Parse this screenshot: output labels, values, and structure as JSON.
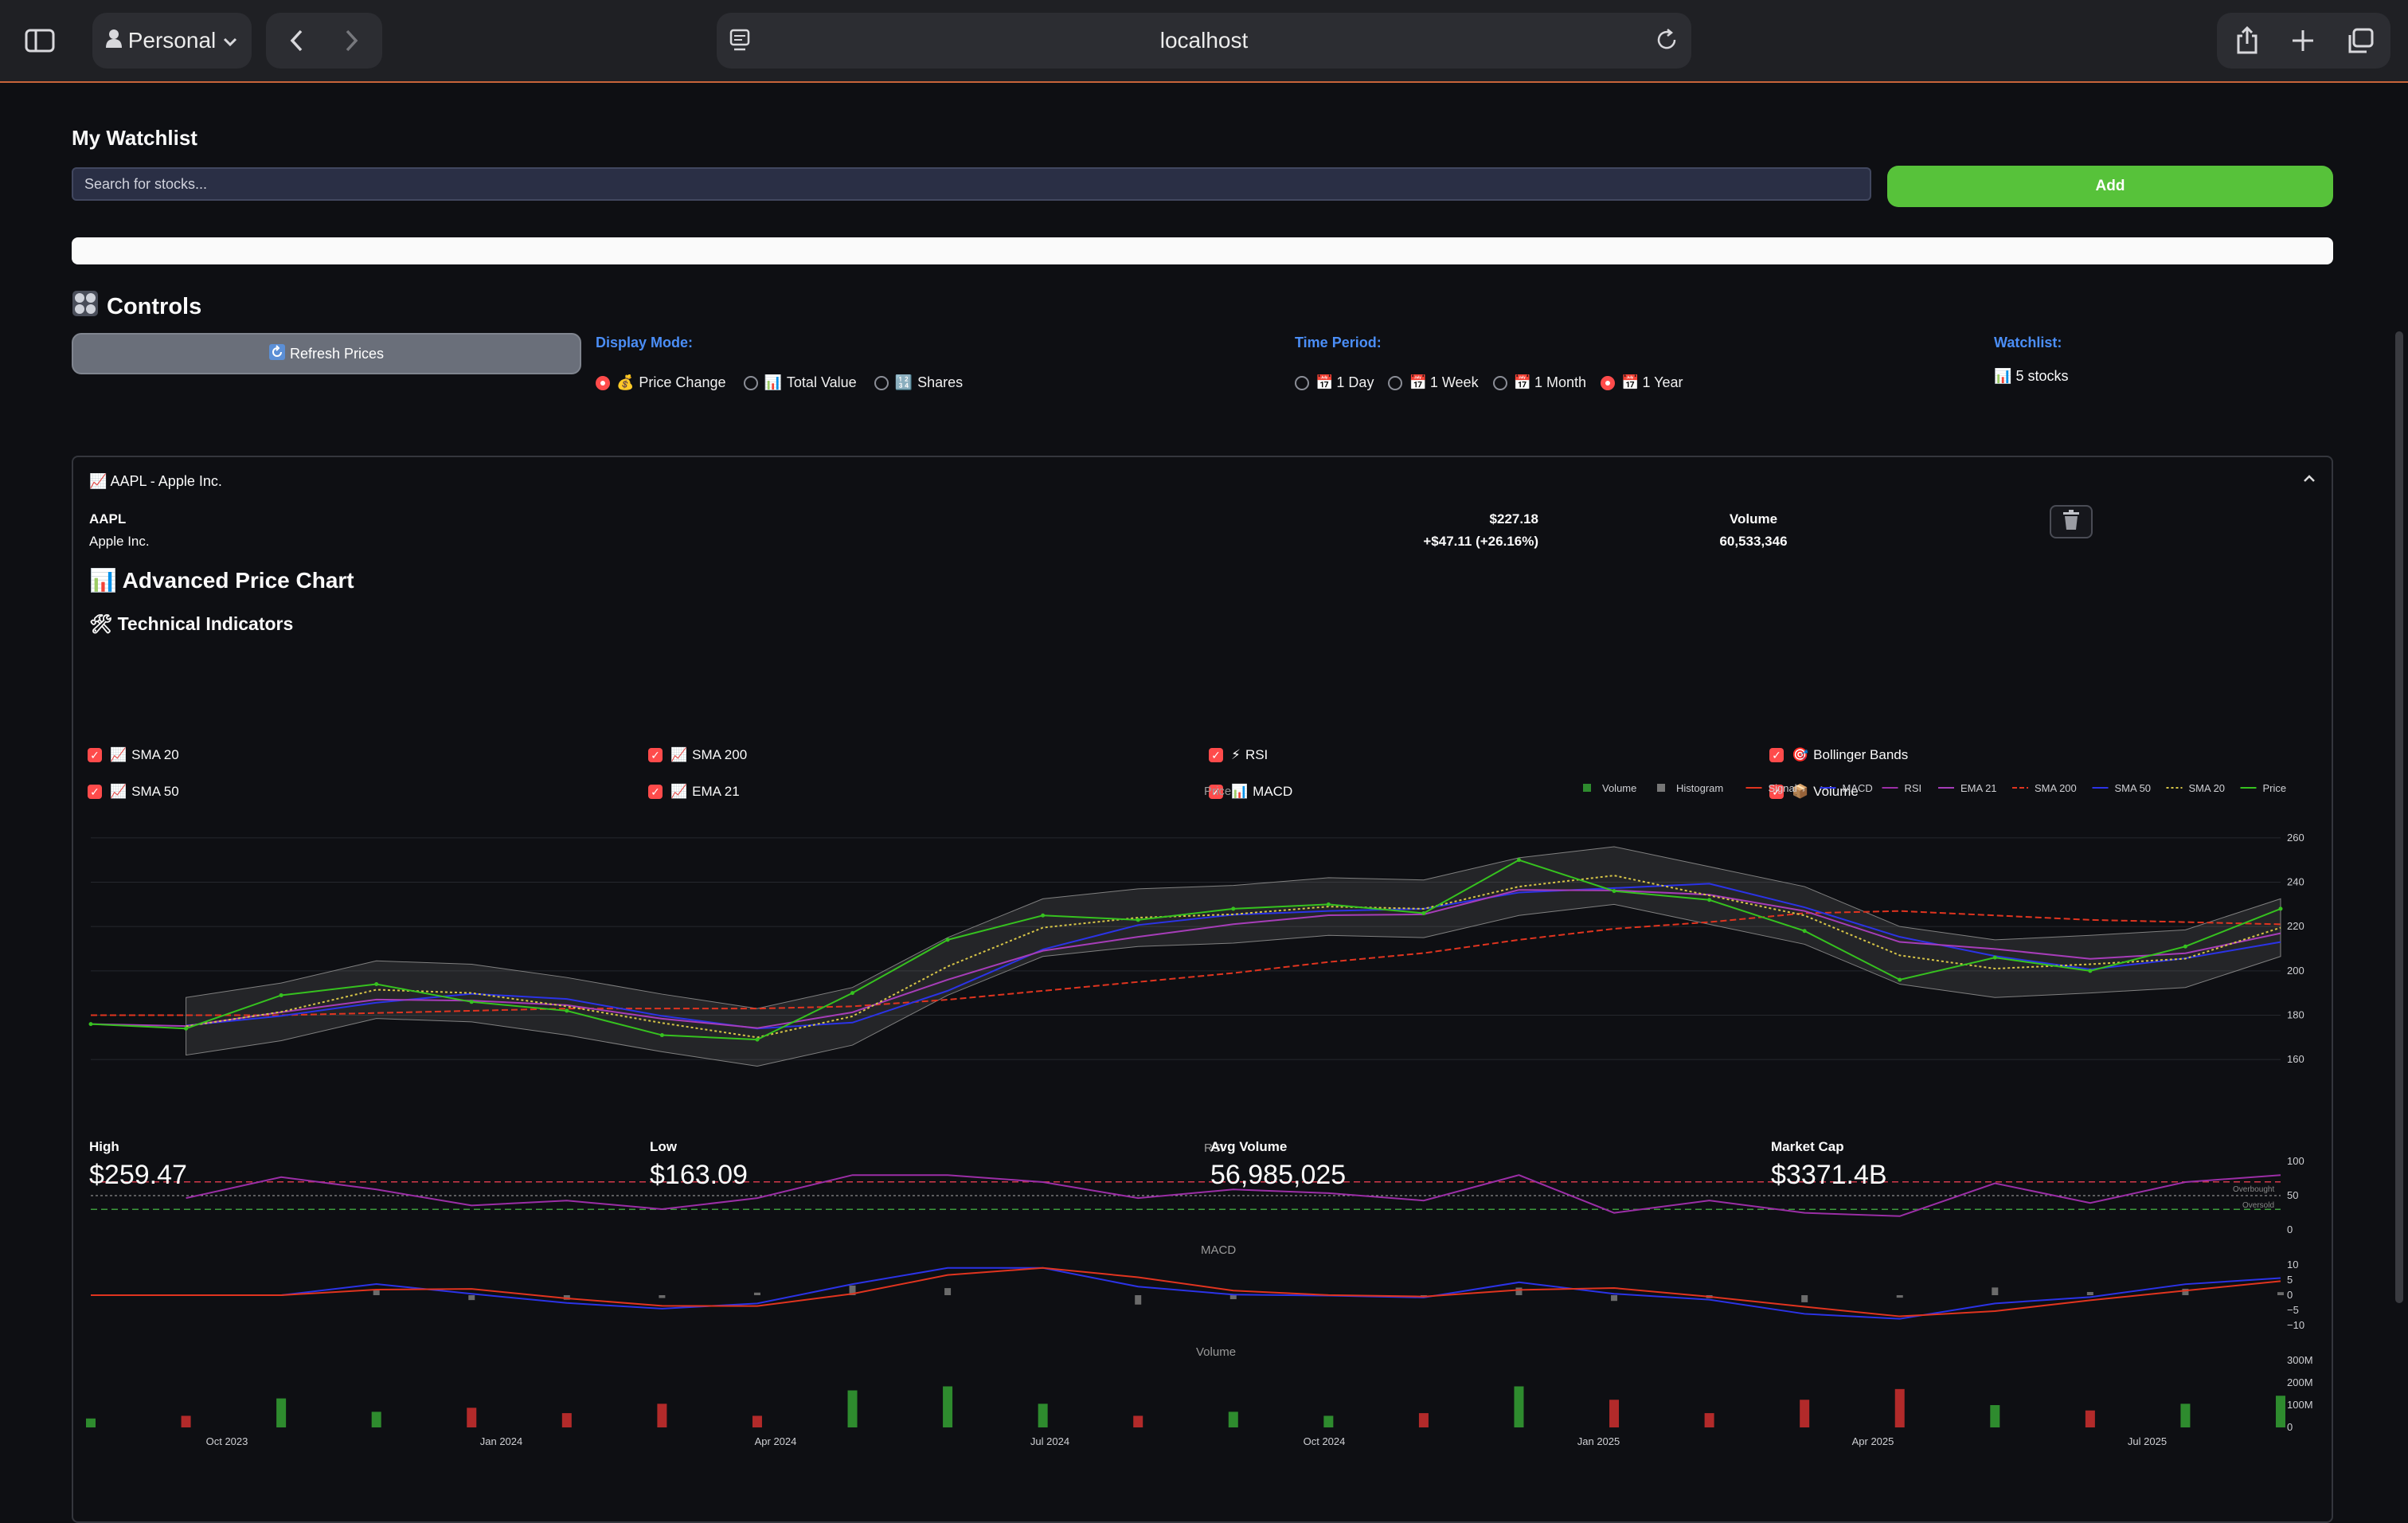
{
  "browser": {
    "profile": "Personal",
    "url": "localhost"
  },
  "watchlist": {
    "title": "My Watchlist",
    "search_placeholder": "Search for stocks...",
    "add_label": "Add"
  },
  "controls": {
    "title": "Controls",
    "refresh_label": "Refresh Prices",
    "display_mode_label": "Display Mode:",
    "display_modes": [
      "Price Change",
      "Total Value",
      "Shares"
    ],
    "display_mode_selected": "Price Change",
    "time_period_label": "Time Period:",
    "time_periods": [
      "1 Day",
      "1 Week",
      "1 Month",
      "1 Year"
    ],
    "time_period_selected": "1 Year",
    "watchlist_label": "Watchlist:",
    "watchlist_count": "5 stocks"
  },
  "stock": {
    "header": "AAPL - Apple Inc.",
    "symbol": "AAPL",
    "name": "Apple Inc.",
    "price": "$227.18",
    "change": "+$47.11 (+26.16%)",
    "volume_label": "Volume",
    "volume": "60,533,346",
    "chart_title": "Advanced Price Chart",
    "indicators_title": "Technical Indicators",
    "indicators": [
      {
        "label": "SMA 20",
        "checked": true
      },
      {
        "label": "SMA 200",
        "checked": true
      },
      {
        "label": "RSI",
        "checked": true
      },
      {
        "label": "Bollinger Bands",
        "checked": true
      },
      {
        "label": "SMA 50",
        "checked": true
      },
      {
        "label": "EMA 21",
        "checked": true
      },
      {
        "label": "MACD",
        "checked": true
      },
      {
        "label": "Volume",
        "checked": true
      }
    ],
    "stats": [
      {
        "label": "High",
        "value": "$259.47"
      },
      {
        "label": "Low",
        "value": "$163.09"
      },
      {
        "label": "Avg Volume",
        "value": "56,985,025"
      },
      {
        "label": "Market Cap",
        "value": "$3371.4B"
      }
    ]
  },
  "chart_data": {
    "type": "line",
    "subplot_titles": [
      "Price",
      "RSI",
      "MACD",
      "Volume"
    ],
    "legend": [
      "Volume",
      "Histogram",
      "Signal",
      "MACD",
      "RSI",
      "EMA 21",
      "SMA 200",
      "SMA 50",
      "SMA 20",
      "Price"
    ],
    "legend_position": "top-right",
    "x_ticks": [
      "Oct 2023",
      "Jan 2024",
      "Apr 2024",
      "Jul 2024",
      "Oct 2024",
      "Jan 2025",
      "Apr 2025",
      "Jul 2025"
    ],
    "price_yticks": [
      "260",
      "240",
      "220",
      "200",
      "180",
      "160"
    ],
    "rsi_yticks": [
      "100",
      "50",
      "0"
    ],
    "macd_yticks": [
      "10",
      "5",
      "0",
      "−5",
      "−10"
    ],
    "volume_yticks": [
      "300M",
      "200M",
      "100M",
      "0"
    ],
    "rsi_annotations": [
      "Overbought",
      "Oversold"
    ],
    "price_series": {
      "x": [
        "Sep 2023",
        "Oct 2023",
        "Nov 2023",
        "Dec 2023",
        "Jan 2024",
        "Feb 2024",
        "Mar 2024",
        "Apr 2024",
        "May 2024",
        "Jun 2024",
        "Jul 2024",
        "Aug 2024",
        "Sep 2024",
        "Oct 2024",
        "Nov 2024",
        "Dec 2024",
        "Jan 2025",
        "Feb 2025",
        "Mar 2025",
        "Apr 2025",
        "May 2025",
        "Jun 2025",
        "Jul 2025",
        "Aug 2025"
      ],
      "price": [
        176,
        174,
        189,
        194,
        186,
        182,
        171,
        169,
        190,
        214,
        225,
        223,
        228,
        230,
        226,
        250,
        236,
        232,
        218,
        196,
        206,
        200,
        211,
        228
      ],
      "sma200": [
        180,
        180,
        180,
        181,
        182,
        183,
        183,
        183,
        184,
        187,
        191,
        195,
        199,
        204,
        208,
        214,
        219,
        222,
        226,
        227,
        225,
        223,
        222,
        221
      ]
    },
    "colors": {
      "price": "#36c21f",
      "sma20": "#d6c447",
      "sma50": "#2b33e6",
      "sma200": "#e0341f",
      "ema21": "#a63db8",
      "bands": "#808080",
      "rsi": "#9b2ea6",
      "macd": "#2b33e6",
      "signal": "#e0341f",
      "vol_up": "#2e8b2e",
      "vol_down": "#b22a2a"
    }
  }
}
